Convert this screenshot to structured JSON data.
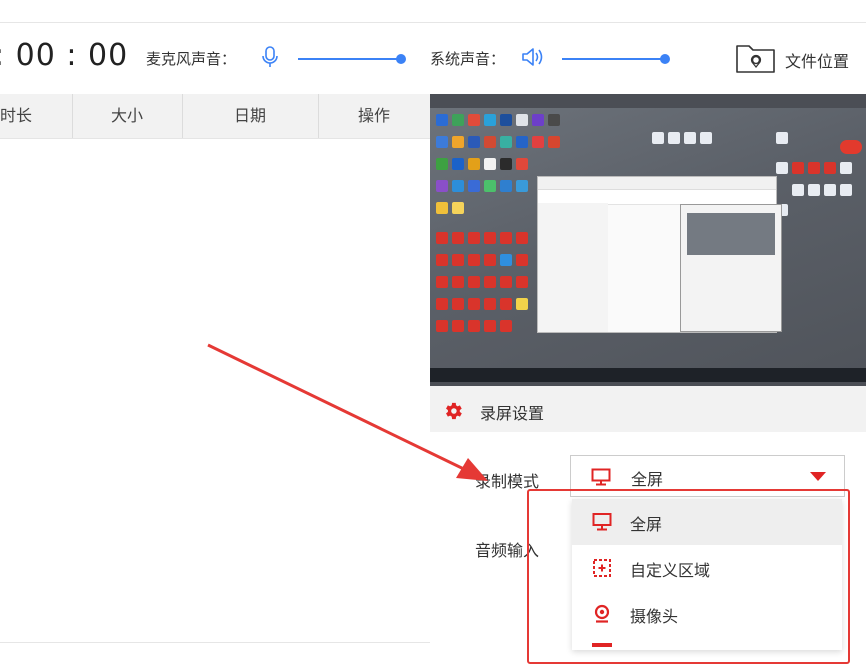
{
  "toolbar": {
    "timer": ": 00 : 00",
    "mic_label": "麦克风声音：",
    "system_label": "系统声音：",
    "folder_label": "文件位置"
  },
  "table": {
    "columns": [
      "时长",
      "大小",
      "日期",
      "操作"
    ]
  },
  "settings": {
    "title": "录屏设置",
    "record_mode_label": "录制模式",
    "audio_input_label": "音频输入",
    "record_mode_value": "全屏",
    "options": [
      "全屏",
      "自定义区域",
      "摄像头"
    ]
  },
  "colors": {
    "accent_blue": "#3b82f6",
    "accent_red": "#e02424"
  },
  "icons": {
    "mic": "microphone-icon",
    "speaker": "speaker-icon",
    "folder": "folder-location-icon",
    "gear": "gear-icon",
    "fullscreen": "monitor-icon",
    "region": "custom-region-icon",
    "camera": "camera-icon"
  }
}
